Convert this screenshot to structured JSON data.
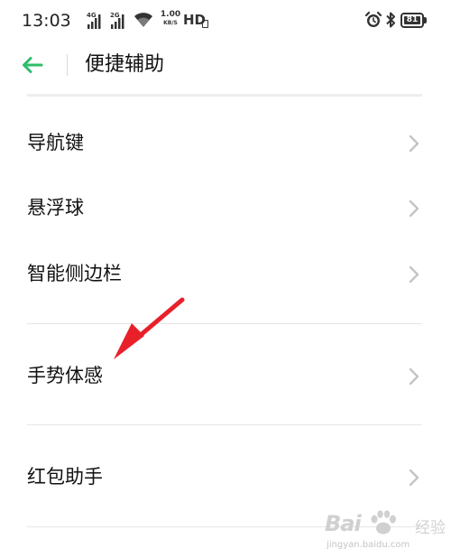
{
  "status_bar": {
    "time": "13:03",
    "sim1_network": "4G",
    "sim2_network": "2G",
    "speed_value": "1.00",
    "speed_unit": "KB/S",
    "hd_label": "HD",
    "battery_level": "81"
  },
  "header": {
    "title": "便捷辅助"
  },
  "items": [
    {
      "label": "导航键"
    },
    {
      "label": "悬浮球"
    },
    {
      "label": "智能侧边栏"
    },
    {
      "label": "手势体感"
    },
    {
      "label": "红包助手"
    }
  ],
  "colors": {
    "accent": "#2ebd6b",
    "annotation_arrow": "#e8202a",
    "chevron": "#c4c4c4"
  },
  "watermark": {
    "logo_text": "Bai",
    "logo_text_suffix": "经验",
    "url": "jingyan.baidu.com"
  }
}
